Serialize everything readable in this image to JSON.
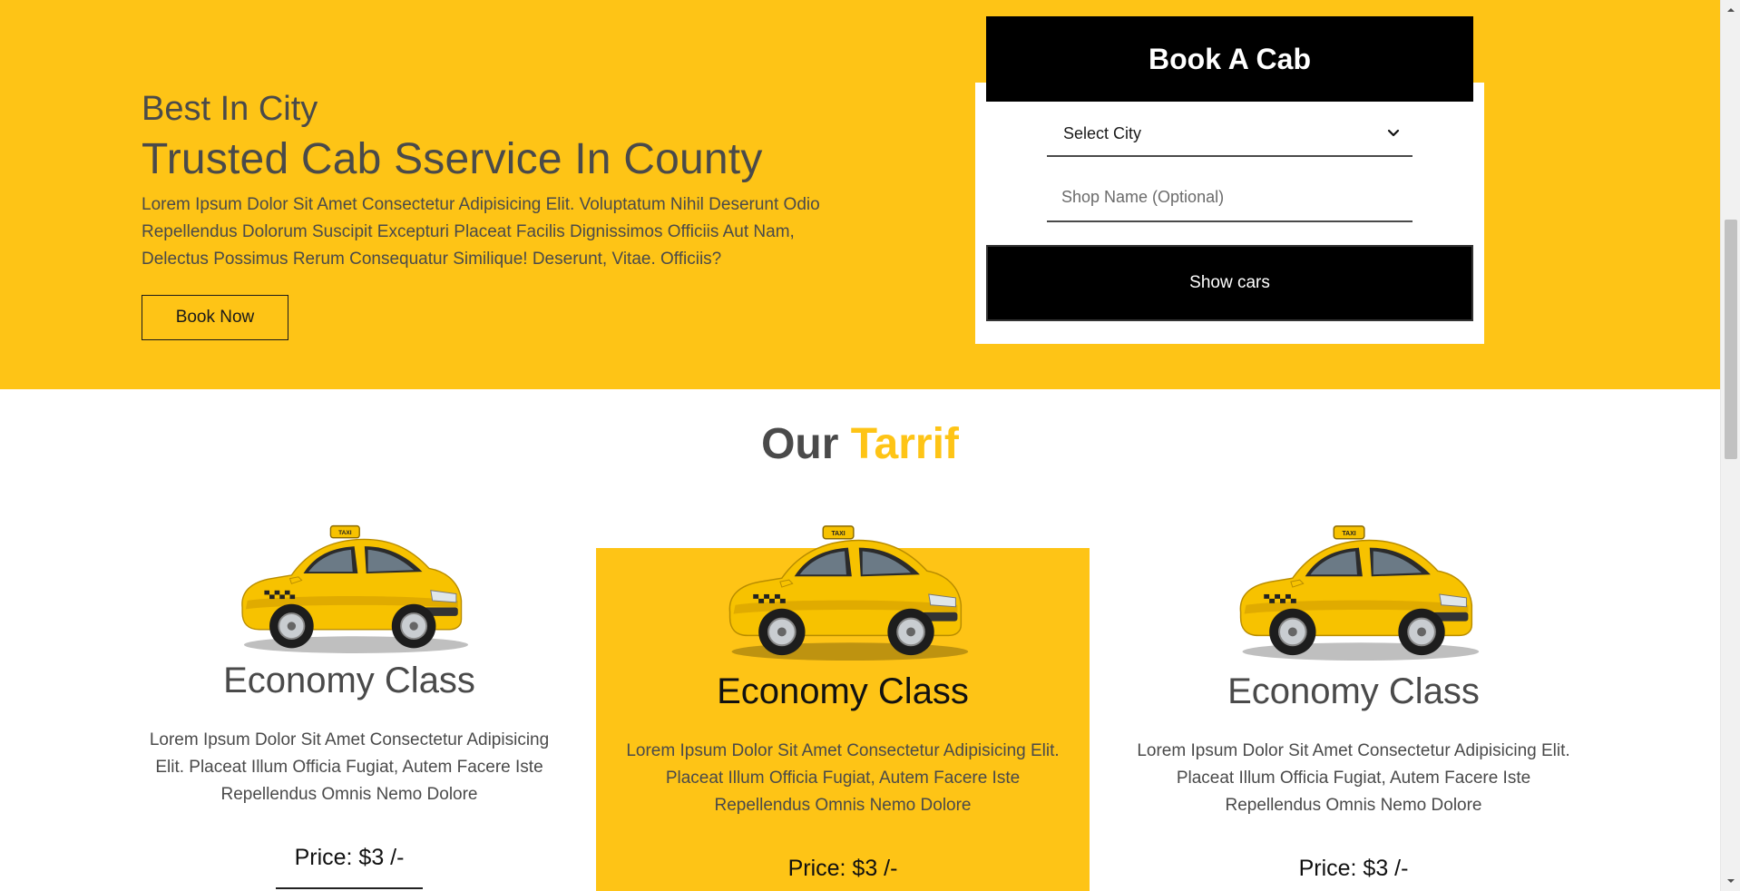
{
  "hero": {
    "kicker": "Best In City",
    "title": "Trusted Cab Sservice In County",
    "description": "Lorem Ipsum Dolor Sit Amet Consectetur Adipisicing Elit. Voluptatum Nihil Deserunt Odio Repellendus Dolorum Suscipit Excepturi Placeat Facilis Dignissimos Officiis Aut Nam, Delectus Possimus Rerum Consequatur Similique! Deserunt, Vitae. Officiis?",
    "book_now_label": "Book Now"
  },
  "booking": {
    "title": "Book A Cab",
    "city_select_value": "Select City",
    "shop_placeholder": "Shop Name (Optional)",
    "show_cars_label": "Show cars"
  },
  "tariff": {
    "title_main": "Our",
    "title_accent": "Tarrif",
    "cards": [
      {
        "title": "Economy Class",
        "description": "Lorem Ipsum Dolor Sit Amet Consectetur Adipisicing Elit. Placeat Illum Officia Fugiat, Autem Facere Iste Repellendus Omnis Nemo Dolore",
        "price": "Price: $3 /-"
      },
      {
        "title": "Economy Class",
        "description": "Lorem Ipsum Dolor Sit Amet Consectetur Adipisicing Elit. Placeat Illum Officia Fugiat, Autem Facere Iste Repellendus Omnis Nemo Dolore",
        "price": "Price: $3 /-"
      },
      {
        "title": "Economy Class",
        "description": "Lorem Ipsum Dolor Sit Amet Consectetur Adipisicing Elit. Placeat Illum Officia Fugiat, Autem Facere Iste Repellendus Omnis Nemo Dolore",
        "price": "Price: $3 /-"
      }
    ]
  },
  "colors": {
    "brand_yellow": "#fec416",
    "dark": "#000000",
    "text": "#4a4a4a"
  },
  "icons": {
    "select_chevron": "chevron-down-icon",
    "car_image": "taxi-car-icon"
  }
}
